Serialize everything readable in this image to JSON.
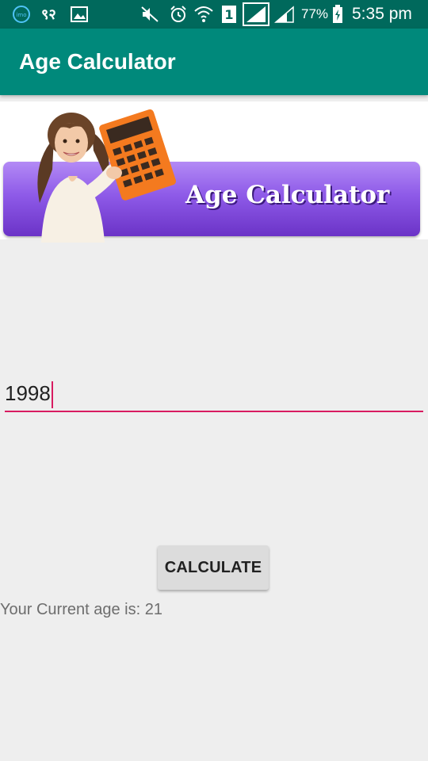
{
  "status_bar": {
    "left_icons": [
      "imo-icon",
      "whatsapp-counter-icon",
      "gallery-icon"
    ],
    "counter_text": "९२",
    "sim_label": "1",
    "battery": "77%",
    "time": "5:35 pm",
    "right_icons": [
      "mute-icon",
      "alarm-icon",
      "wifi-icon",
      "sim-icon",
      "signal-icon",
      "signal-icon-2",
      "battery-icon"
    ]
  },
  "app_bar": {
    "title": "Age Calculator"
  },
  "banner": {
    "text": "Age Calculator"
  },
  "form": {
    "year_value": "1998",
    "button_label": "CALCULATE",
    "result_text": "Your Current age is: 21"
  },
  "colors": {
    "status_bar": "#00695c",
    "app_bar": "#00897b",
    "accent": "#d81b60",
    "background": "#eeeeee",
    "banner_purple": "#7c45d8",
    "calculator_orange": "#f47a1f"
  }
}
